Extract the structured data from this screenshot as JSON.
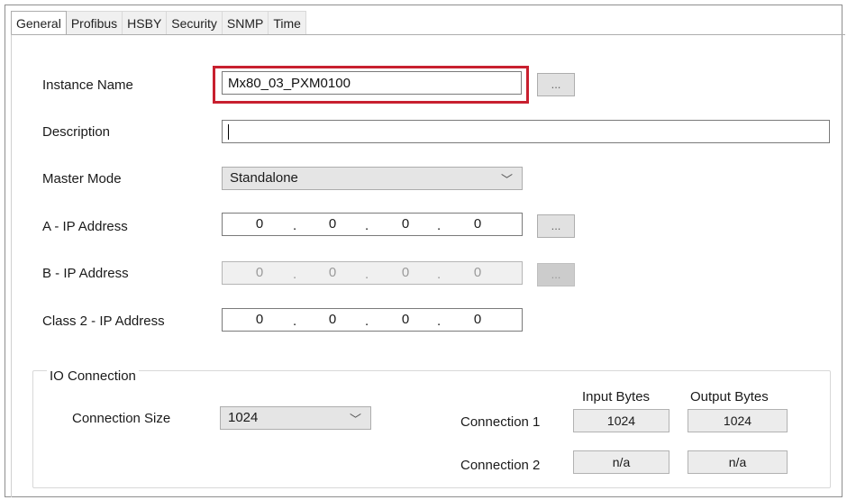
{
  "tabs": [
    {
      "label": "General",
      "active": true
    },
    {
      "label": "Profibus",
      "active": false
    },
    {
      "label": "HSBY",
      "active": false
    },
    {
      "label": "Security",
      "active": false
    },
    {
      "label": "SNMP",
      "active": false
    },
    {
      "label": "Time",
      "active": false
    }
  ],
  "fields": {
    "instance_name": {
      "label": "Instance Name",
      "value": "Mx80_03_PXM0100",
      "browse_label": "..."
    },
    "description": {
      "label": "Description",
      "value": ""
    },
    "master_mode": {
      "label": "Master Mode",
      "value": "Standalone"
    },
    "a_ip": {
      "label": "A - IP Address",
      "octets": [
        "0",
        "0",
        "0",
        "0"
      ],
      "browse_label": "..."
    },
    "b_ip": {
      "label": "B - IP Address",
      "octets": [
        "0",
        "0",
        "0",
        "0"
      ],
      "browse_label": "...",
      "disabled": true
    },
    "class2_ip": {
      "label": "Class 2 - IP Address",
      "octets": [
        "0",
        "0",
        "0",
        "0"
      ]
    }
  },
  "io_connection": {
    "title": "IO Connection",
    "size_label": "Connection Size",
    "size_value": "1024",
    "input_header": "Input Bytes",
    "output_header": "Output Bytes",
    "rows": [
      {
        "label": "Connection 1",
        "input": "1024",
        "output": "1024"
      },
      {
        "label": "Connection 2",
        "input": "n/a",
        "output": "n/a"
      }
    ]
  },
  "ip_separator": ".",
  "dropdown_icon": "chevron-down-icon",
  "colors": {
    "highlight": "#c8202f",
    "border": "#7a7a7a",
    "disabled_bg": "#f0f0f0"
  }
}
